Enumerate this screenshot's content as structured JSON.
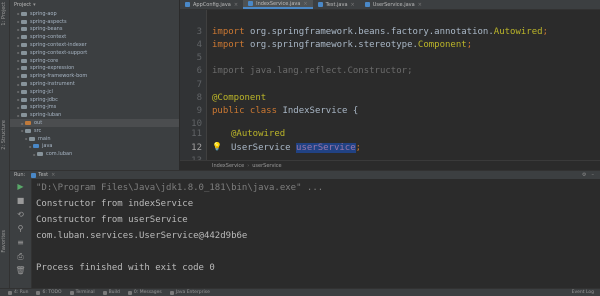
{
  "tool_strip": {
    "labels": [
      "1: Project",
      "2: Structure",
      "Favorites"
    ]
  },
  "project": {
    "title": "Project",
    "items": [
      {
        "label": "spring-aop",
        "depth": 1,
        "color": "gray"
      },
      {
        "label": "spring-aspects",
        "depth": 1,
        "color": "gray"
      },
      {
        "label": "spring-beans",
        "depth": 1,
        "color": "gray"
      },
      {
        "label": "spring-context",
        "depth": 1,
        "color": "gray"
      },
      {
        "label": "spring-context-indexer",
        "depth": 1,
        "color": "gray"
      },
      {
        "label": "spring-context-support",
        "depth": 1,
        "color": "gray"
      },
      {
        "label": "spring-core",
        "depth": 1,
        "color": "gray"
      },
      {
        "label": "spring-expression",
        "depth": 1,
        "color": "gray"
      },
      {
        "label": "spring-framework-bom",
        "depth": 1,
        "color": "gray"
      },
      {
        "label": "spring-instrument",
        "depth": 1,
        "color": "gray"
      },
      {
        "label": "spring-jcl",
        "depth": 1,
        "color": "gray"
      },
      {
        "label": "spring-jdbc",
        "depth": 1,
        "color": "gray"
      },
      {
        "label": "spring-jms",
        "depth": 1,
        "color": "gray"
      },
      {
        "label": "spring-luban",
        "depth": 1,
        "color": "gray"
      },
      {
        "label": "out",
        "depth": 2,
        "color": "orange",
        "selected": true
      },
      {
        "label": "src",
        "depth": 2,
        "color": "gray"
      },
      {
        "label": "main",
        "depth": 3,
        "color": "gray"
      },
      {
        "label": "java",
        "depth": 4,
        "color": "blue"
      },
      {
        "label": "com.luban",
        "depth": 5,
        "color": "gray"
      }
    ]
  },
  "tabs": [
    {
      "label": "AppConfig.java",
      "color": "#4a88c7",
      "active": false
    },
    {
      "label": "IndexService.java",
      "color": "#4a88c7",
      "active": true
    },
    {
      "label": "Test.java",
      "color": "#4a88c7",
      "active": false
    },
    {
      "label": "UserService.java",
      "color": "#4a88c7",
      "active": false
    }
  ],
  "editor": {
    "line_numbers": [
      "3",
      "4",
      "5",
      "6",
      "7",
      "8",
      "9",
      "10",
      "11",
      "12",
      "13"
    ],
    "current_line": "12",
    "code": {
      "l3_kw": "import ",
      "l3_pkg": "org.springframework.beans.factory.annotation.",
      "l3_cls": "Autowired",
      "l3_end": ";",
      "l5_kw": "import ",
      "l5_pkg": "org.springframework.stereotype.",
      "l5_cls": "Component",
      "l5_end": ";",
      "l7_dim": "import java.lang.reflect.Constructor;",
      "l9_ann": "@Component",
      "l10_kw": "public class ",
      "l10_name": "IndexService {",
      "l12_ann": "@Autowired",
      "l13_type": "UserService ",
      "l13_field": "userService",
      "l13_end": ";"
    }
  },
  "breadcrumb": {
    "class_name": "IndexService",
    "field_name": "userService"
  },
  "run": {
    "label": "Run:",
    "tab_label": "Test",
    "console_lines": [
      {
        "text": "\"D:\\Program Files\\Java\\jdk1.8.0_181\\bin\\java.exe\" ...",
        "kind": "cmd"
      },
      {
        "text": "Constructor from indexService",
        "kind": "out"
      },
      {
        "text": "Constructor from userService",
        "kind": "out"
      },
      {
        "text": "com.luban.services.UserService@442d9b6e",
        "kind": "out"
      },
      {
        "text": "",
        "kind": "out"
      },
      {
        "text": "Process finished with exit code 0",
        "kind": "out"
      }
    ]
  },
  "bottom_bar": {
    "items": [
      "4: Run",
      "6: TODO",
      "Terminal",
      "Build",
      "0: Messages",
      "Java Enterprise"
    ],
    "right": "Event Log"
  },
  "icons": {
    "run_tools": [
      "rerun-icon",
      "stop-icon",
      "restore-layout-icon",
      "pin-icon",
      "scroll-icon",
      "print-icon",
      "trash-icon"
    ]
  }
}
